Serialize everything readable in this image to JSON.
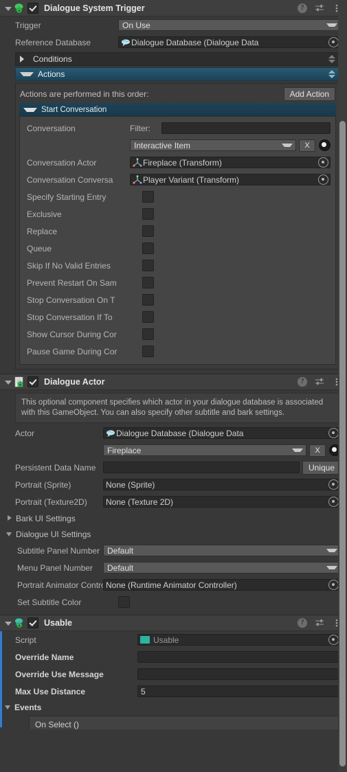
{
  "theme": {
    "background": "#383838",
    "header_bg": "#3f3f3f",
    "accent_teal": "#1d4356",
    "override_blue": "#2c7fd4",
    "field_dark": "#2b2b2b",
    "dropdown_bg": "#585858",
    "script_icon_green": "#2bb5a0",
    "component_icon_green": "#3ec75a"
  },
  "components": [
    {
      "title": "Dialogue System Trigger",
      "enabled": true,
      "expanded": true,
      "icon": "dialogue-system-trigger-icon",
      "header_icons": [
        "help-icon",
        "preset-icon",
        "more-menu-icon"
      ],
      "fields": {
        "trigger": {
          "label": "Trigger",
          "value": "On Use",
          "type": "dropdown"
        },
        "reference_database": {
          "label": "Reference Database",
          "value": "Dialogue Database (Dialogue Data",
          "type": "object-field",
          "icon": "dialogue-database-icon"
        }
      },
      "foldouts": {
        "conditions": {
          "label": "Conditions",
          "expanded": false
        },
        "actions": {
          "label": "Actions",
          "expanded": true
        }
      },
      "actions": {
        "note": "Actions are performed in this order:",
        "add_button": "Add Action",
        "items": [
          {
            "title": "Start Conversation",
            "expanded": true,
            "rows": [
              {
                "label": "Conversation",
                "type": "filter-label",
                "filter_label": "Filter:",
                "filter_value": ""
              },
              {
                "label": "",
                "type": "conversation-dropdown",
                "value": "Interactive Item",
                "clear_button": "X"
              },
              {
                "label": "Conversation Actor",
                "type": "object-field",
                "value": "Fireplace (Transform)",
                "icon": "transform-icon"
              },
              {
                "label": "Conversation Conversa",
                "type": "object-field",
                "value": "Player Variant (Transform)",
                "icon": "transform-icon"
              },
              {
                "label": "Specify Starting Entry",
                "type": "checkbox",
                "checked": false
              },
              {
                "label": "Exclusive",
                "type": "checkbox",
                "checked": false
              },
              {
                "label": "Replace",
                "type": "checkbox",
                "checked": false
              },
              {
                "label": "Queue",
                "type": "checkbox",
                "checked": false
              },
              {
                "label": "Skip If No Valid Entries",
                "type": "checkbox",
                "checked": false
              },
              {
                "label": "Prevent Restart On Sam",
                "type": "checkbox",
                "checked": false
              },
              {
                "label": "Stop Conversation On T",
                "type": "checkbox",
                "checked": false
              },
              {
                "label": "Stop Conversation If To",
                "type": "checkbox",
                "checked": false
              },
              {
                "label": "Show Cursor During Cor",
                "type": "checkbox",
                "checked": false
              },
              {
                "label": "Pause Game During Cor",
                "type": "checkbox",
                "checked": false
              }
            ]
          }
        ]
      }
    },
    {
      "title": "Dialogue Actor",
      "enabled": true,
      "expanded": true,
      "icon": "dialogue-actor-script-icon",
      "help_text": "This optional component specifies which actor in your dialogue database is associated with this GameObject. You can also specify other subtitle and bark settings.",
      "fields": {
        "actor": {
          "label": "Actor",
          "value": "Dialogue Database (Dialogue Data",
          "icon": "dialogue-database-icon",
          "dropdown_value": "Fireplace",
          "clear_button": "X"
        },
        "persistent_data_name": {
          "label": "Persistent Data Name",
          "value": "",
          "button": "Unique"
        },
        "portrait_sprite": {
          "label": "Portrait (Sprite)",
          "value": "None (Sprite)"
        },
        "portrait_texture2d": {
          "label": "Portrait (Texture2D)",
          "value": "None (Texture 2D)"
        }
      },
      "foldouts": {
        "bark_ui_settings": {
          "label": "Bark UI Settings",
          "expanded": false
        },
        "dialogue_ui_settings": {
          "label": "Dialogue UI Settings",
          "expanded": true
        }
      },
      "dialogue_ui_fields": {
        "subtitle_panel_number": {
          "label": "Subtitle Panel Number",
          "value": "Default"
        },
        "menu_panel_number": {
          "label": "Menu Panel Number",
          "value": "Default"
        },
        "portrait_animator_controller": {
          "label": "Portrait Animator Contro",
          "value": "None (Runtime Animator Controller)"
        },
        "set_subtitle_color": {
          "label": "Set Subtitle Color",
          "checked": false
        }
      }
    },
    {
      "title": "Usable",
      "enabled": true,
      "expanded": true,
      "icon": "usable-component-icon",
      "has_override_bar": true,
      "fields": {
        "script": {
          "label": "Script",
          "value": "Usable"
        },
        "override_name": {
          "label": "Override Name",
          "value": ""
        },
        "override_use_message": {
          "label": "Override Use Message",
          "value": ""
        },
        "max_use_distance": {
          "label": "Max Use Distance",
          "value": "5"
        }
      },
      "events": {
        "label": "Events",
        "expanded": true,
        "entries": [
          {
            "label": "On Select ()"
          }
        ]
      }
    }
  ]
}
